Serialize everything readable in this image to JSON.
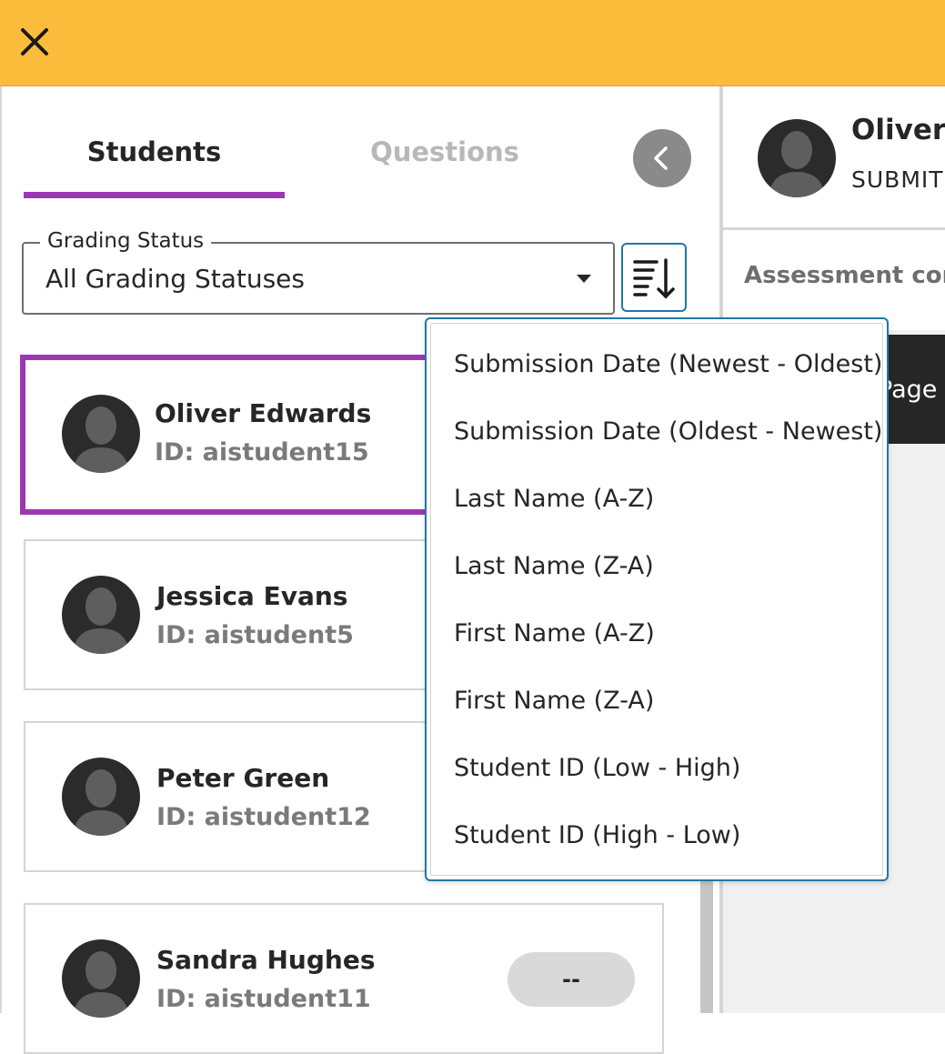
{
  "tabs": {
    "students": "Students",
    "questions": "Questions"
  },
  "grading_status": {
    "label": "Grading Status",
    "value": "All Grading Statuses"
  },
  "students": [
    {
      "name": "Oliver Edwards",
      "id": "ID: aistudent15"
    },
    {
      "name": "Jessica Evans",
      "id": "ID: aistudent5"
    },
    {
      "name": "Peter Green",
      "id": "ID: aistudent12"
    },
    {
      "name": "Sandra Hughes",
      "id": "ID: aistudent11",
      "grade": "--"
    }
  ],
  "sort_menu": [
    "Submission Date (Newest - Oldest)",
    "Submission Date (Oldest - Newest)",
    "Last Name (A-Z)",
    "Last Name (Z-A)",
    "First Name (A-Z)",
    "First Name (Z-A)",
    "Student ID (Low - High)",
    "Student ID (High - Low)"
  ],
  "right_panel": {
    "name": "Oliver",
    "status": "SUBMIT",
    "content_label": "Assessment cont",
    "page_button": "Page"
  },
  "colors": {
    "header": "#fbbc3c",
    "accent": "#9c37b3",
    "focus": "#1f78a8"
  },
  "icons": [
    "close-icon",
    "chevron-left-icon",
    "sort-icon",
    "caret-down-icon",
    "avatar-icon"
  ]
}
